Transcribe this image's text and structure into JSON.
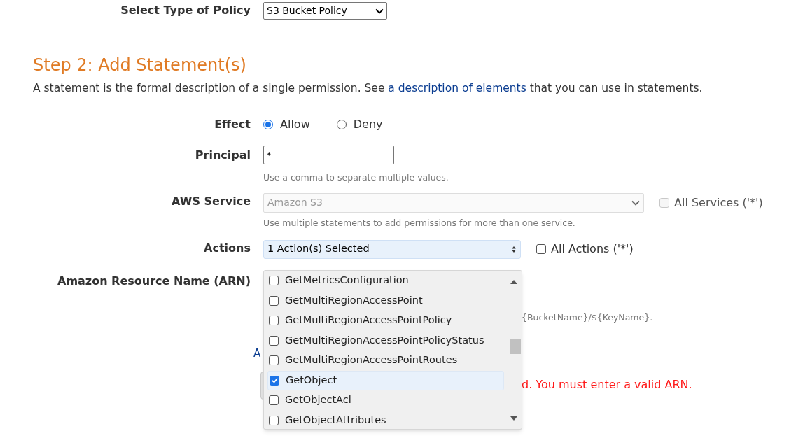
{
  "policy_type": {
    "label": "Select Type of Policy",
    "value": "S3 Bucket Policy"
  },
  "step": {
    "heading": "Step 2: Add Statement(s)",
    "description_before": "A statement is the formal description of a single permission. See ",
    "description_link": "a description of elements",
    "description_after": " that you can use in statements."
  },
  "effect": {
    "label": "Effect",
    "options": [
      {
        "label": "Allow",
        "selected": true
      },
      {
        "label": "Deny",
        "selected": false
      }
    ]
  },
  "principal": {
    "label": "Principal",
    "value": "*",
    "hint": "Use a comma to separate multiple values."
  },
  "aws_service": {
    "label": "AWS Service",
    "value": "Amazon S3",
    "disabled": true,
    "hint": "Use multiple statements to add permissions for more than one service.",
    "all_option": {
      "label": "All Services ('*')",
      "checked": false,
      "disabled": true
    }
  },
  "actions": {
    "label": "Actions",
    "value": "1 Action(s) Selected",
    "all_option": {
      "label": "All Actions ('*')",
      "checked": false
    },
    "dropdown": {
      "items": [
        {
          "label": "GetMetricsConfiguration",
          "checked": false,
          "selected": false
        },
        {
          "label": "GetMultiRegionAccessPoint",
          "checked": false,
          "selected": false
        },
        {
          "label": "GetMultiRegionAccessPointPolicy",
          "checked": false,
          "selected": false
        },
        {
          "label": "GetMultiRegionAccessPointPolicyStatus",
          "checked": false,
          "selected": false
        },
        {
          "label": "GetMultiRegionAccessPointRoutes",
          "checked": false,
          "selected": false
        },
        {
          "label": "GetObject",
          "checked": true,
          "selected": true
        },
        {
          "label": "GetObjectAcl",
          "checked": false,
          "selected": false
        },
        {
          "label": "GetObjectAttributes",
          "checked": false,
          "selected": false
        }
      ]
    }
  },
  "arn": {
    "label": "Amazon Resource Name (ARN)",
    "hint_fragment": "{BucketName}/${KeyName}.",
    "link_fragment": "A",
    "error_fragment": "d. You must enter a valid ARN."
  }
}
